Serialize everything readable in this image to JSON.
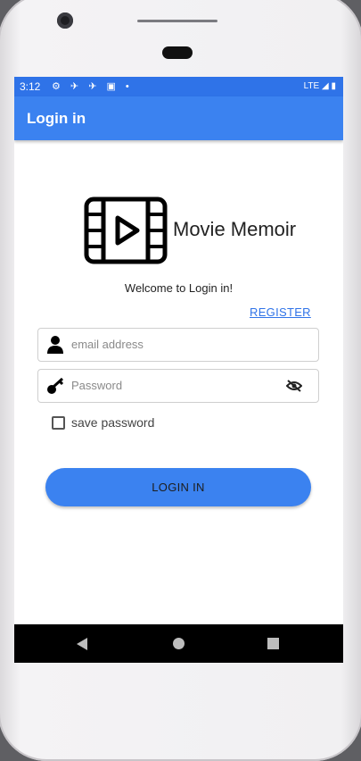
{
  "status_bar": {
    "time": "3:12",
    "icons": "⚙ ✈ ✈ ▣ •",
    "network": "LTE"
  },
  "app_bar": {
    "title": "Login in"
  },
  "logo": {
    "app_name": "Movie Memoir"
  },
  "welcome_text": "Welcome to Login in!",
  "register_link": "REGISTER",
  "email_field": {
    "placeholder": "email address"
  },
  "password_field": {
    "placeholder": "Password"
  },
  "save_password": {
    "label": "save password",
    "checked": false
  },
  "login_button": {
    "label": "LOGIN IN"
  },
  "colors": {
    "primary": "#3b82f0",
    "status_bar": "#2f73e8"
  }
}
